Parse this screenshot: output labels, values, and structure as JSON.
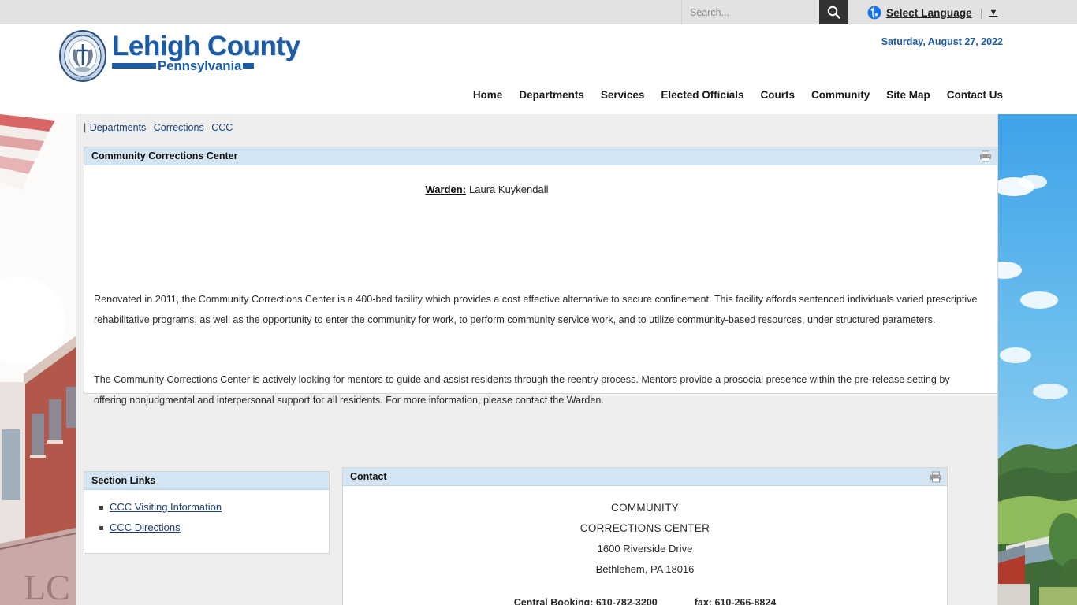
{
  "topbar": {
    "search": {
      "placeholder": "Search...",
      "value": "",
      "button_icon": "search-icon"
    },
    "translate": {
      "icon": "globe-icon",
      "label": "Select Language",
      "separator": "|",
      "caret": "▼"
    }
  },
  "masthead": {
    "logo": {
      "main": "Lehigh County",
      "sub": "Pennsylvania",
      "seal_icon": "county-seal-icon"
    },
    "date": "Saturday, August 27, 2022",
    "nav": [
      {
        "label": "Home"
      },
      {
        "label": "Departments"
      },
      {
        "label": "Services"
      },
      {
        "label": "Elected Officials"
      },
      {
        "label": "Courts"
      },
      {
        "label": "Community"
      },
      {
        "label": "Site Map"
      },
      {
        "label": "Contact Us"
      }
    ]
  },
  "breadcrumb": {
    "leading": "|",
    "items": [
      {
        "label": "Departments"
      },
      {
        "label": "Corrections"
      },
      {
        "label": "CCC"
      }
    ]
  },
  "main_panel": {
    "title": "Community Corrections Center",
    "print_icon": "printer-icon",
    "warden_label": "Warden:",
    "warden_name": "Laura Kuykendall",
    "paragraphs": [
      "Renovated in 2011, the Community Corrections Center is a 400-bed facility which provides a cost effective alternative to secure confinement.  This facility affords sentenced individuals varied prescriptive rehabilitative programs, as well as the opportunity to enter the community for work, to perform community service work, and to utilize community-based resources, under structured parameters.",
      "The Community Corrections Center is actively looking for mentors to guide and assist residents through the reentry process.  Mentors provide a prosocial presence within the pre-release setting by offering nonjudgmental and interpersonal support for all residents.  For more information, please contact the Warden."
    ]
  },
  "section_links": {
    "title": "Section Links",
    "items": [
      {
        "label": "CCC Visiting Information"
      },
      {
        "label": "CCC Directions"
      }
    ]
  },
  "contact": {
    "title": "Contact",
    "print_icon": "printer-icon",
    "lines": [
      "COMMUNITY",
      "CORRECTIONS CENTER",
      "1600 Riverside Drive",
      "Bethlehem, PA 18016"
    ],
    "phone_label": "Central Booking:",
    "phone_number": "610-782-3200",
    "fax_label": "fax:",
    "fax_number": "610-266-8824"
  },
  "photos": {
    "left_alt": "county-building-photo",
    "right_alt": "farmland-landscape-photo"
  },
  "colors": {
    "brand_blue": "#1d5ca4",
    "panel_header": "#d3e5f3",
    "link": "#1d3f73",
    "page_bg": "#eeeeee",
    "topbar_bg": "#e2e2e2"
  }
}
